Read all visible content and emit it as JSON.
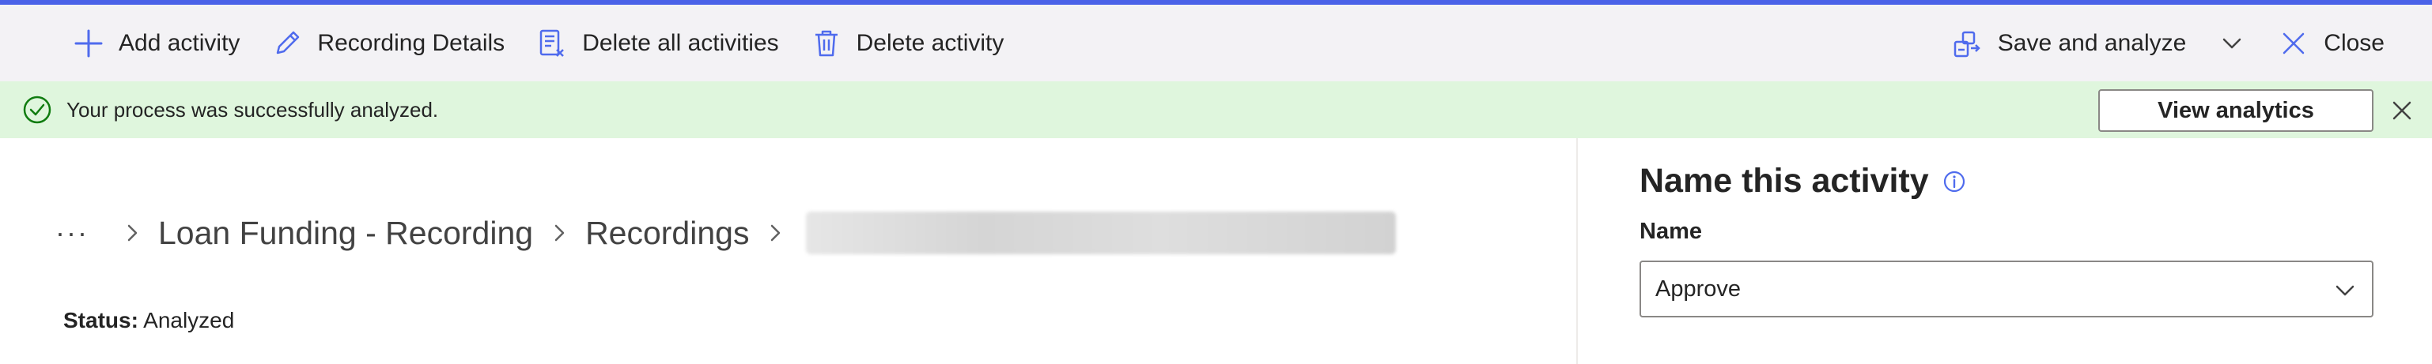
{
  "toolbar": {
    "add_activity": "Add activity",
    "recording_details": "Recording Details",
    "delete_all": "Delete all activities",
    "delete_activity": "Delete activity",
    "save_analyze": "Save and analyze",
    "close": "Close"
  },
  "banner": {
    "message": "Your process was successfully analyzed.",
    "view_analytics": "View analytics"
  },
  "breadcrumb": {
    "more": "···",
    "items": [
      "Loan Funding - Recording",
      "Recordings"
    ]
  },
  "status": {
    "label": "Status:",
    "value": "Analyzed"
  },
  "panel": {
    "title": "Name this activity",
    "field_label": "Name",
    "field_value": "Approve"
  },
  "colors": {
    "accent": "#4a62e8",
    "icon_blue": "#4f6bed",
    "success_bg": "#dff6dd",
    "success_icon": "#107c10"
  },
  "icons": [
    "add-icon",
    "pencil-icon",
    "delete-list-icon",
    "trash-icon",
    "save-analyze-icon",
    "chevron-down-icon",
    "close-icon",
    "checkmark-circle-icon",
    "dismiss-icon",
    "chevron-right-icon",
    "info-icon"
  ]
}
